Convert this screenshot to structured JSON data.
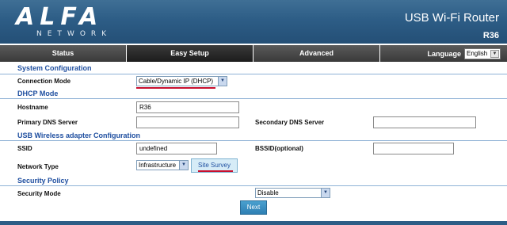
{
  "header": {
    "logo_main": "ALFA",
    "logo_sub": "NETWORK",
    "product": "USB Wi-Fi Router",
    "model": "R36"
  },
  "nav": {
    "tabs": [
      {
        "label": "Status"
      },
      {
        "label": "Easy Setup"
      },
      {
        "label": "Advanced"
      }
    ],
    "language_label": "Language",
    "language_value": "English"
  },
  "system_config": {
    "heading": "System Configuration",
    "connection_mode_label": "Connection Mode",
    "connection_mode_value": "Cable/Dynamic IP (DHCP)"
  },
  "dhcp": {
    "heading": "DHCP Mode",
    "hostname_label": "Hostname",
    "hostname_value": "R36",
    "primary_dns_label": "Primary DNS Server",
    "primary_dns_value": "",
    "secondary_dns_label": "Secondary DNS Server",
    "secondary_dns_value": ""
  },
  "usb_wireless": {
    "heading": "USB Wireless adapter Configuration",
    "ssid_label": "SSID",
    "ssid_value": "undefined",
    "bssid_label": "BSSID(optional)",
    "bssid_value": "",
    "network_type_label": "Network Type",
    "network_type_value": "Infrastructure",
    "site_survey_label": "Site Survey"
  },
  "security": {
    "heading": "Security Policy",
    "mode_label": "Security Mode",
    "mode_value": "Disable"
  },
  "actions": {
    "next_label": "Next"
  }
}
